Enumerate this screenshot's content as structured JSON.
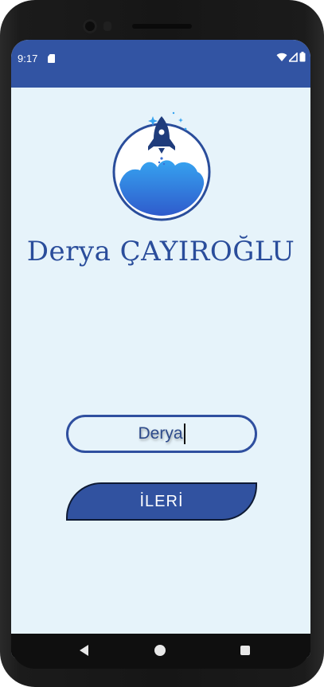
{
  "status_bar": {
    "time": "9:17",
    "icons": [
      "sd-card-icon",
      "wifi-icon",
      "cell-signal-icon",
      "battery-icon"
    ]
  },
  "logo": {
    "icon": "rocket-icon"
  },
  "brand": {
    "name": "Derya ÇAYIROĞLU"
  },
  "form": {
    "name_value": "Derya",
    "next_label": "İLERİ"
  },
  "nav": {
    "icons": [
      "back-icon",
      "home-icon",
      "recents-icon"
    ]
  },
  "colors": {
    "accent": "#3254a3",
    "background": "#e6f3fa",
    "brand_text": "#2a4d9b"
  }
}
